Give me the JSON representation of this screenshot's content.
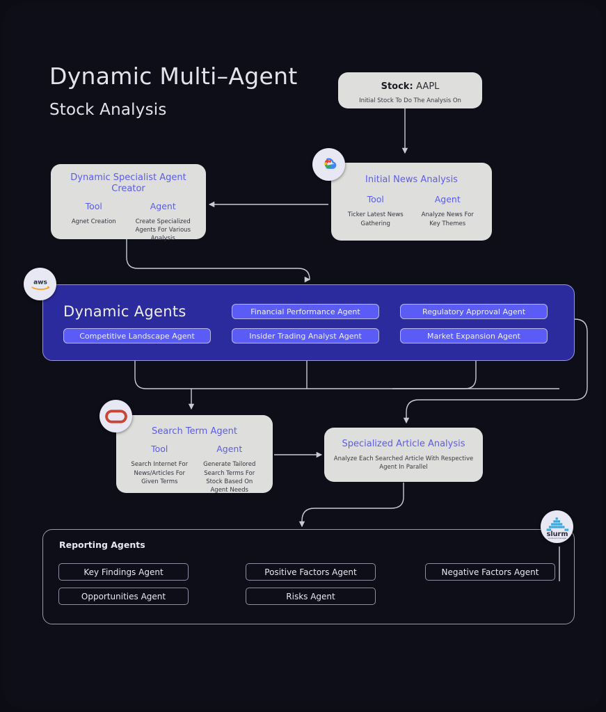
{
  "header": {
    "title_line1": "Dynamic Multi–Agent",
    "title_line2": "Stock Analysis"
  },
  "stock_card": {
    "label": "Stock:",
    "ticker": "AAPL",
    "subtitle": "Initial Stock To Do The Analysis On"
  },
  "initial_news_card": {
    "title": "Initial News Analysis",
    "tool_head": "Tool",
    "tool_body": "Ticker Latest News Gathering",
    "agent_head": "Agent",
    "agent_body": "Analyze News For Key Themes",
    "badge": "google-cloud-icon"
  },
  "specialist_card": {
    "title": "Dynamic Specialist Agent Creator",
    "tool_head": "Tool",
    "tool_body": "Agnet Creation",
    "agent_head": "Agent",
    "agent_body": "Create Specialized Agents For Various Analysis"
  },
  "dynamic_agents": {
    "title": "Dynamic Agents",
    "badge": "aws-icon",
    "pills": [
      "Competitive Landscape Agent",
      "Financial Performance Agent",
      "Insider Trading Analyst Agent",
      "Regulatory Approval Agent",
      "Market Expansion Agent"
    ]
  },
  "search_term_card": {
    "title": "Search Term Agent",
    "tool_head": "Tool",
    "tool_body": "Search Internet For News/Articles For Given Terms",
    "agent_head": "Agent",
    "agent_body": "Generate Tailored Search Terms For Stock Based On Agent Needs",
    "badge": "oracle-icon"
  },
  "specialized_article_card": {
    "title": "Specialized Article Analysis",
    "subtitle": "Analyze Each Searched Article With Respective Agent In Parallel"
  },
  "reporting": {
    "title": "Reporting Agents",
    "badge": "slurm-icon",
    "badge_label": "slurm",
    "badge_sublabel": "workload manager",
    "pills": [
      "Key Findings Agent",
      "Positive Factors Agent",
      "Negative Factors Agent",
      "Opportunities Agent",
      "Risks Agent"
    ]
  },
  "colors": {
    "background": "#0b0c14",
    "canvas": "#0d0e18",
    "card": "#dededc",
    "accent_purple": "#5b5bf0",
    "panel_purple": "#2c2b9e",
    "pill_purple": "#5b5bf5",
    "connector": "#c9cad4",
    "text_light": "#e3e4ea"
  }
}
